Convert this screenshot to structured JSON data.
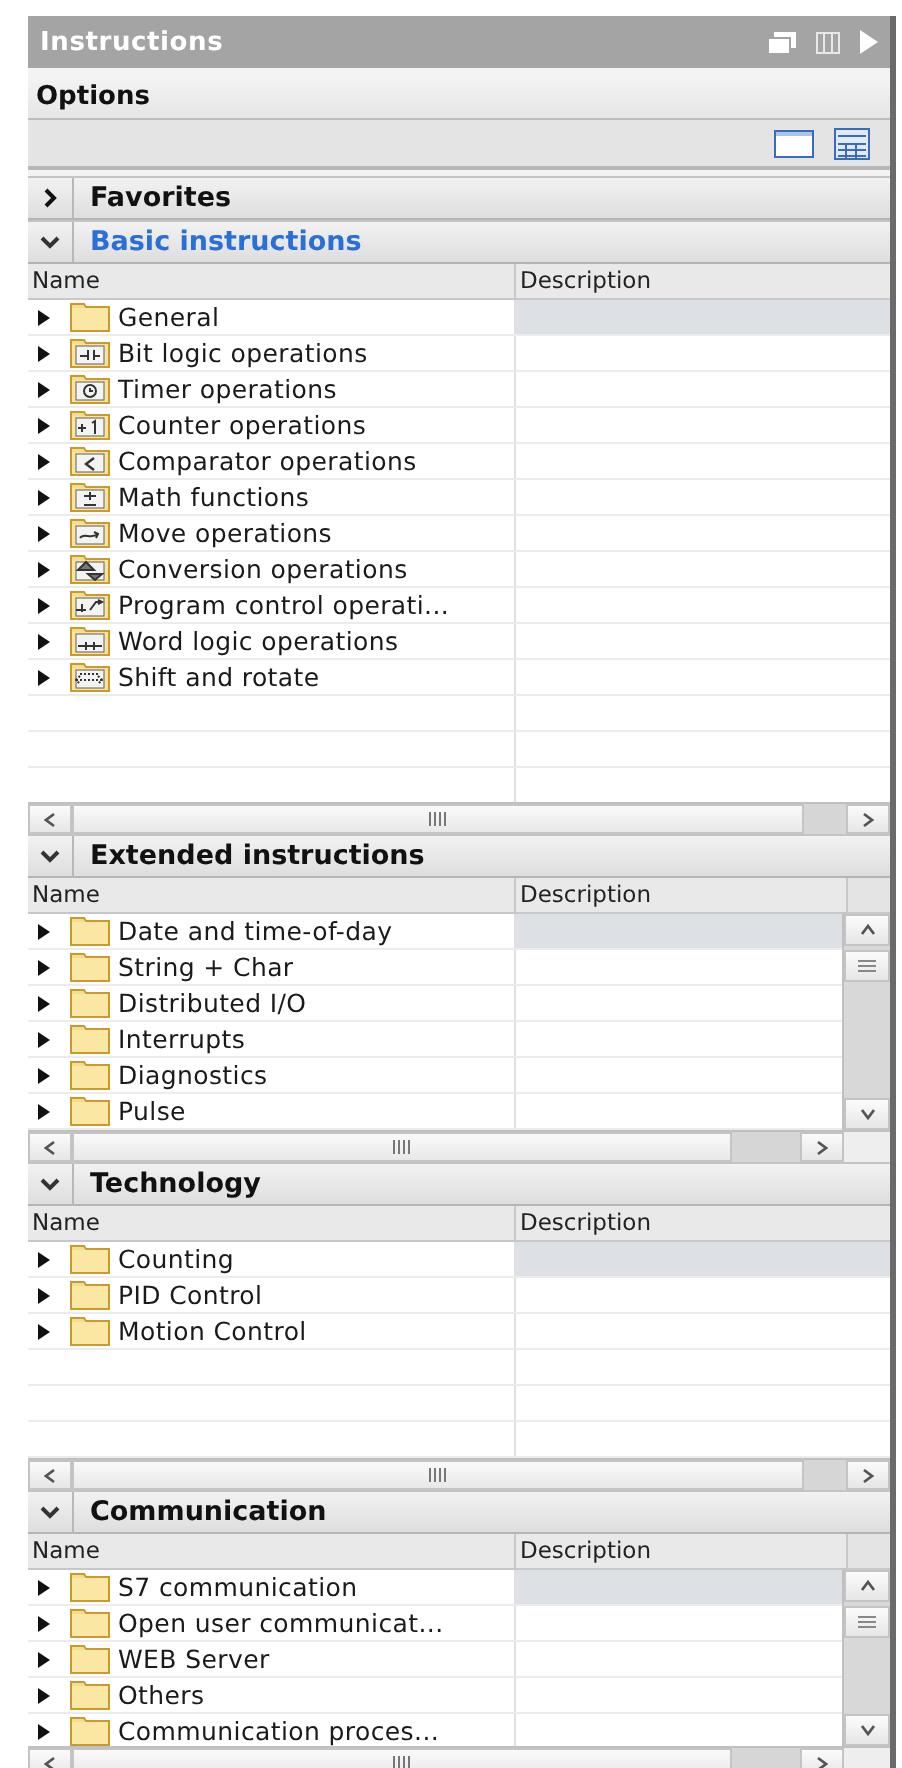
{
  "title_bar": {
    "title": "Instructions"
  },
  "options": {
    "label": "Options"
  },
  "sections": [
    {
      "title": "Favorites",
      "expanded": false,
      "active": false
    },
    {
      "title": "Basic instructions",
      "expanded": true,
      "active": true,
      "vertical_scroll": false,
      "columns": [
        "Name",
        "Description"
      ],
      "items": [
        {
          "name": "General",
          "kind": "folder",
          "selected": true
        },
        {
          "name": "Bit logic operations",
          "kind": "bit",
          "selected": false
        },
        {
          "name": "Timer operations",
          "kind": "timer",
          "selected": false
        },
        {
          "name": "Counter operations",
          "kind": "counter",
          "selected": false
        },
        {
          "name": "Comparator operations",
          "kind": "comparator",
          "selected": false
        },
        {
          "name": "Math functions",
          "kind": "math",
          "selected": false
        },
        {
          "name": "Move operations",
          "kind": "move",
          "selected": false
        },
        {
          "name": "Conversion operations",
          "kind": "conversion",
          "selected": false
        },
        {
          "name": "Program control operati...",
          "kind": "program",
          "selected": false
        },
        {
          "name": "Word logic operations",
          "kind": "word",
          "selected": false
        },
        {
          "name": "Shift and rotate",
          "kind": "shift",
          "selected": false
        }
      ]
    },
    {
      "title": "Extended instructions",
      "expanded": true,
      "active": false,
      "vertical_scroll": true,
      "columns": [
        "Name",
        "Description"
      ],
      "items": [
        {
          "name": "Date and time-of-day",
          "kind": "folder",
          "selected": true
        },
        {
          "name": "String + Char",
          "kind": "folder",
          "selected": false
        },
        {
          "name": "Distributed I/O",
          "kind": "folder",
          "selected": false
        },
        {
          "name": "Interrupts",
          "kind": "folder",
          "selected": false
        },
        {
          "name": "Diagnostics",
          "kind": "folder",
          "selected": false
        },
        {
          "name": "Pulse",
          "kind": "folder",
          "selected": false
        }
      ]
    },
    {
      "title": "Technology",
      "expanded": true,
      "active": false,
      "vertical_scroll": false,
      "columns": [
        "Name",
        "Description"
      ],
      "items": [
        {
          "name": "Counting",
          "kind": "folder",
          "selected": true
        },
        {
          "name": "PID Control",
          "kind": "folder",
          "selected": false
        },
        {
          "name": "Motion Control",
          "kind": "folder",
          "selected": false
        }
      ]
    },
    {
      "title": "Communication",
      "expanded": true,
      "active": false,
      "vertical_scroll": true,
      "columns": [
        "Name",
        "Description"
      ],
      "items": [
        {
          "name": "S7 communication",
          "kind": "folder",
          "selected": true
        },
        {
          "name": "Open user communicat...",
          "kind": "folder",
          "selected": false
        },
        {
          "name": "WEB Server",
          "kind": "folder",
          "selected": false
        },
        {
          "name": "Others",
          "kind": "folder",
          "selected": false
        },
        {
          "name": "Communication proces...",
          "kind": "folder",
          "selected": false
        }
      ]
    }
  ]
}
